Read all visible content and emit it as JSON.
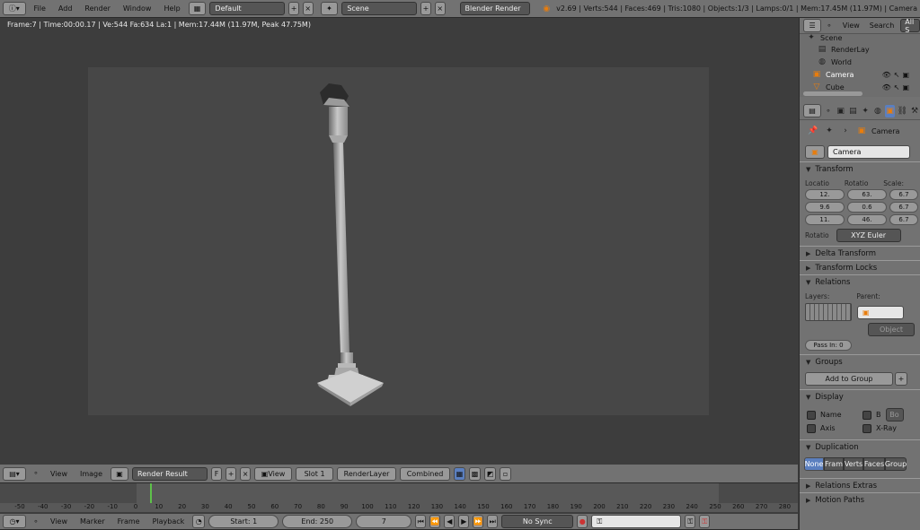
{
  "top_bar": {
    "menus": [
      "File",
      "Add",
      "Render",
      "Window",
      "Help"
    ],
    "layout": "Default",
    "scene": "Scene",
    "engine": "Blender Render",
    "stats": "v2.69 | Verts:544 | Faces:469 | Tris:1080 | Objects:1/3 | Lamps:0/1 | Mem:17.45M (11.97M) | Camera"
  },
  "viewport": {
    "info": "Frame:7 | Time:00:00.17 | Ve:544 Fa:634 La:1 | Mem:17.44M (11.97M, Peak 47.75M)"
  },
  "image_header": {
    "view": "View",
    "image": "Image",
    "render_result": "Render Result",
    "f": "F",
    "view2": "View",
    "slot": "Slot 1",
    "renderlayer": "RenderLayer",
    "combined": "Combined"
  },
  "timeline": {
    "ticks": [
      "-50",
      "-40",
      "-30",
      "-20",
      "-10",
      "0",
      "10",
      "20",
      "30",
      "40",
      "50",
      "60",
      "70",
      "80",
      "90",
      "100",
      "110",
      "120",
      "130",
      "140",
      "150",
      "160",
      "170",
      "180",
      "190",
      "200",
      "210",
      "220",
      "230",
      "240",
      "250",
      "260",
      "270",
      "280"
    ],
    "menus": [
      "View",
      "Marker",
      "Frame",
      "Playback"
    ],
    "start": "Start: 1",
    "end": "End: 250",
    "current": "7",
    "sync": "No Sync"
  },
  "outliner": {
    "view": "View",
    "search": "Search",
    "all": "All S",
    "items": [
      "Scene",
      "RenderLay",
      "World",
      "Camera",
      "Cube"
    ]
  },
  "properties": {
    "breadcrumb": "Camera",
    "object_name": "Camera",
    "transform": {
      "title": "Transform",
      "location_label": "Locatio",
      "rotation_label": "Rotatio",
      "scale_label": "Scale:",
      "location": [
        "12.",
        "9.6",
        "11."
      ],
      "rotation": [
        "63.",
        "0.6",
        "46."
      ],
      "scale": [
        "6.7",
        "6.7",
        "6.7"
      ],
      "rotation_mode_label": "Rotatio",
      "rotation_mode": "XYZ Euler"
    },
    "delta_transform": "Delta Transform",
    "transform_locks": "Transform Locks",
    "relations": {
      "title": "Relations",
      "layers": "Layers:",
      "parent": "Parent:",
      "object": "Object",
      "pass_in": "Pass In: 0"
    },
    "groups": {
      "title": "Groups",
      "add": "Add to Group"
    },
    "display": {
      "title": "Display",
      "name": "Name",
      "b": "B",
      "bo": "Bo",
      "axis": "Axis",
      "xray": "X-Ray"
    },
    "duplication": {
      "title": "Duplication",
      "options": [
        "None",
        "Fram",
        "Verts",
        "Faces",
        "Group"
      ]
    },
    "relations_extras": "Relations Extras",
    "motion_paths": "Motion Paths"
  }
}
